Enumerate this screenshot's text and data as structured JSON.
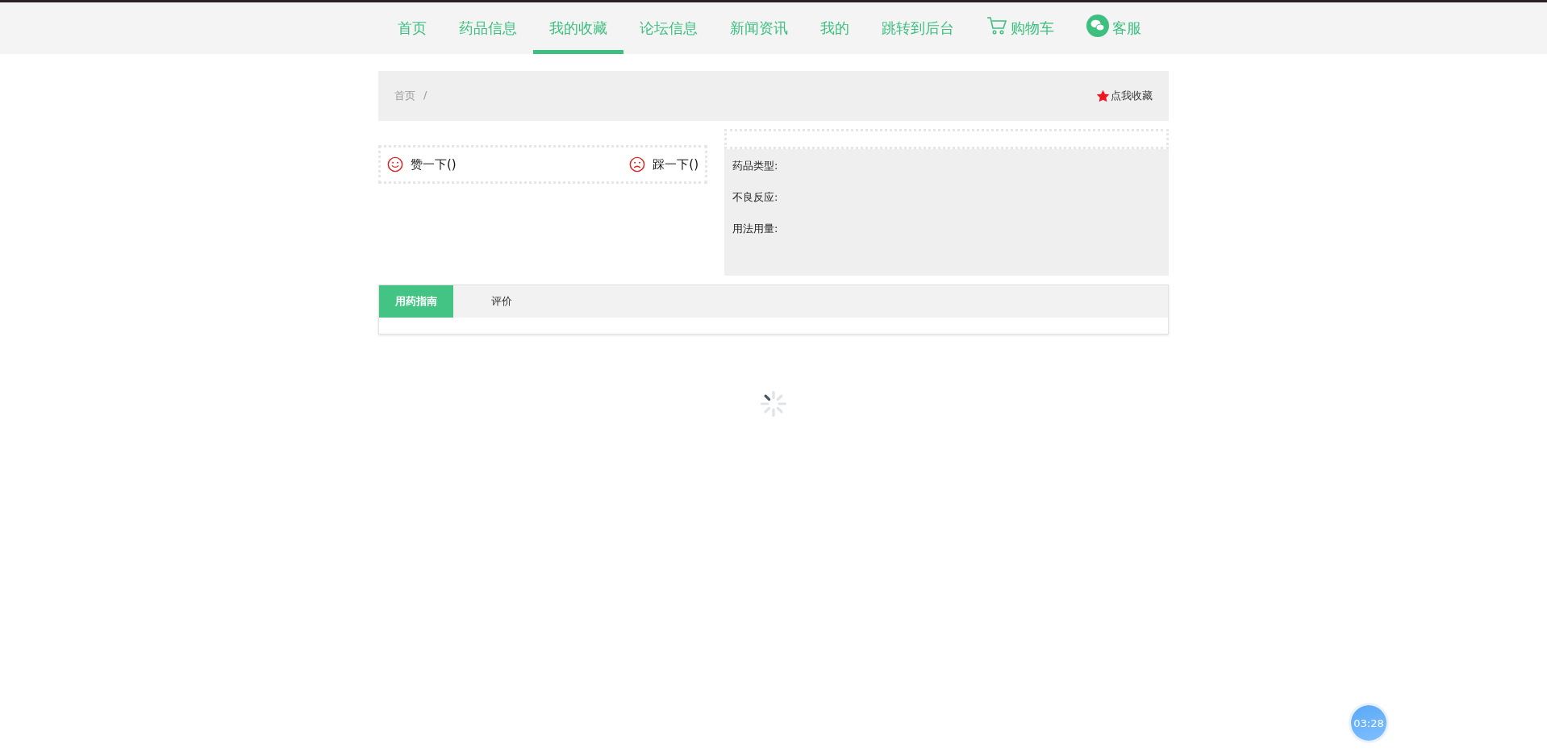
{
  "nav": [
    {
      "label": "首页",
      "selected": false,
      "kind": "text"
    },
    {
      "label": "药品信息",
      "selected": false,
      "kind": "text"
    },
    {
      "label": "我的收藏",
      "selected": true,
      "kind": "text"
    },
    {
      "label": "论坛信息",
      "selected": false,
      "kind": "text"
    },
    {
      "label": "新闻资讯",
      "selected": false,
      "kind": "text"
    },
    {
      "label": "我的",
      "selected": false,
      "kind": "text"
    },
    {
      "label": "跳转到后台",
      "selected": false,
      "kind": "text"
    },
    {
      "label": "购物车",
      "selected": false,
      "kind": "cart"
    },
    {
      "label": "客服",
      "selected": false,
      "kind": "chat"
    }
  ],
  "breadcrumb": {
    "items": [
      "首页"
    ],
    "separator": "/"
  },
  "favorite": {
    "label": "点我收藏"
  },
  "votes": [
    {
      "label": "赞一下()",
      "kind": "like"
    },
    {
      "label": "踩一下()",
      "kind": "dislike"
    }
  ],
  "info": [
    "药品类型:",
    "不良反应:",
    "用法用量:"
  ],
  "tabs": [
    {
      "label": "用药指南",
      "selected": true
    },
    {
      "label": "评价",
      "selected": false
    }
  ],
  "timer": "03:28"
}
